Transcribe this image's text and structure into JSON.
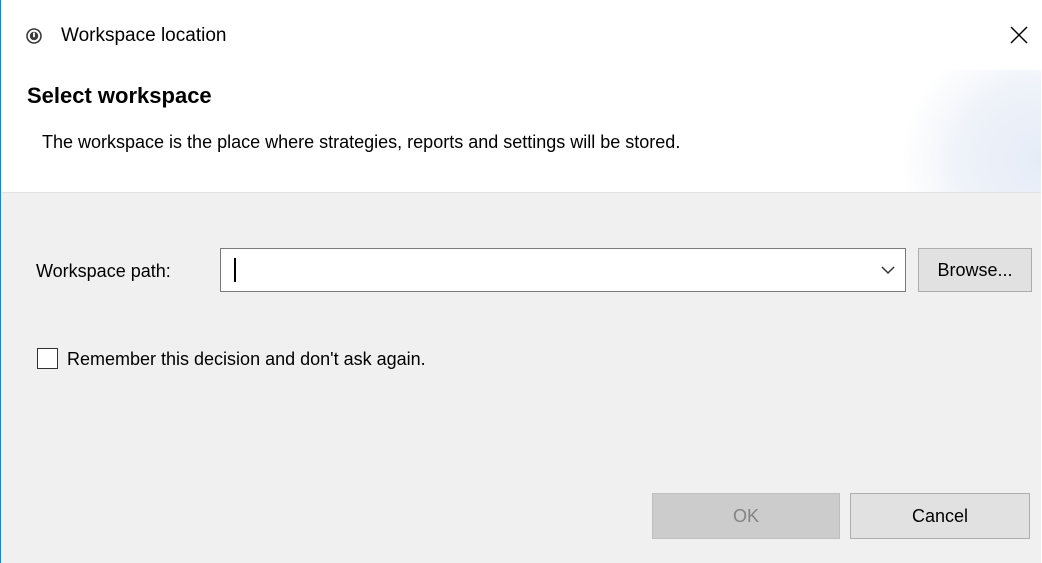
{
  "window": {
    "title": "Workspace location",
    "icon": "app-logo-icon",
    "close_icon": "close-icon"
  },
  "banner": {
    "title": "Select workspace",
    "description": "The workspace is the place where strategies, reports and settings will be stored."
  },
  "form": {
    "path_label": "Workspace path:",
    "path_value": "",
    "dropdown_icon": "chevron-down-icon",
    "browse_label": "Browse...",
    "remember_label": "Remember this decision and don't ask again.",
    "remember_checked": false
  },
  "footer": {
    "ok_label": "OK",
    "ok_enabled": false,
    "cancel_label": "Cancel"
  },
  "colors": {
    "window_border": "#1883d7",
    "dialog_background": "#f0f0f0",
    "banner_background": "#ffffff",
    "button_background": "#e1e1e1",
    "disabled_button_background": "#cccccc"
  }
}
